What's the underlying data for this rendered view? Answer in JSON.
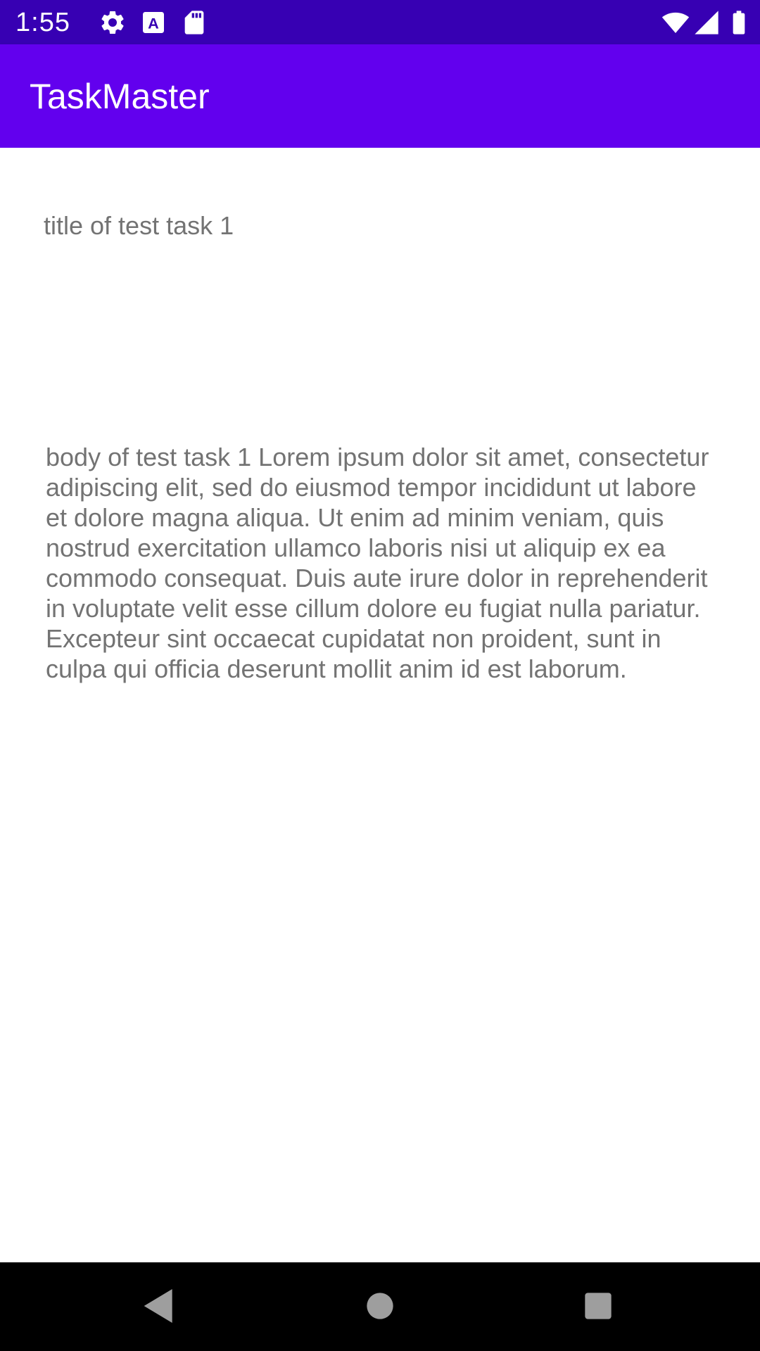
{
  "status_bar": {
    "time": "1:55",
    "icons": [
      "settings-icon",
      "keyboard-a-icon",
      "sd-card-icon",
      "wifi-icon",
      "signal-icon",
      "battery-icon"
    ]
  },
  "app_bar": {
    "title": "TaskMaster"
  },
  "task": {
    "title": "title of test task 1",
    "body": "body of test task 1 Lorem ipsum dolor sit amet, consectetur adipiscing elit, sed do eiusmod tempor incididunt ut labore et dolore magna aliqua. Ut enim ad minim veniam, quis nostrud exercitation ullamco laboris nisi ut aliquip ex ea commodo consequat. Duis aute irure dolor in reprehenderit in voluptate velit esse cillum dolore eu fugiat nulla pariatur. Excepteur sint occaecat cupidatat non proident, sunt in culpa qui officia deserunt mollit anim id est laborum."
  },
  "nav_bar": {
    "buttons": [
      "back-icon",
      "home-icon",
      "recents-icon"
    ]
  },
  "colors": {
    "status_bar": "#3700b3",
    "app_bar": "#6200ee",
    "text": "#737373"
  }
}
